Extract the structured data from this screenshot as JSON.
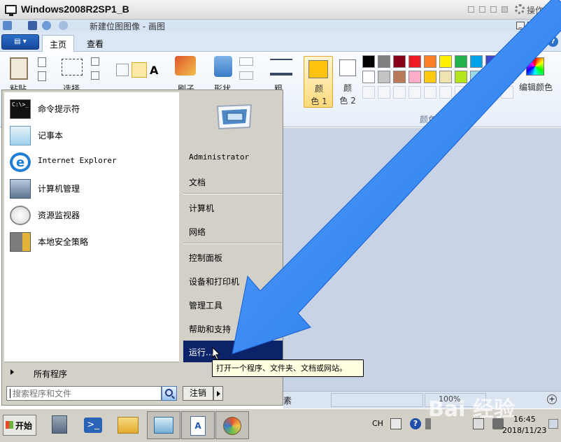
{
  "vm": {
    "title": "Windows2008R2SP1_B",
    "ops_label": "操作"
  },
  "paint": {
    "title": "新建位图图像 - 画图",
    "tabs": [
      "主页",
      "查看"
    ],
    "help": "?",
    "labels": {
      "paste": "粘贴",
      "select": "选择",
      "brush": "刷子",
      "shapes": "形状",
      "size": "粗",
      "color1": "颜\n色 1",
      "color2": "颜\n色 2",
      "edit_colors": "编辑颜色",
      "colors_group": "颜色"
    },
    "color1_value": "#ffc20e",
    "palette_row1": [
      "#000000",
      "#7f7f7f",
      "#880015",
      "#ed1c24",
      "#ff7f27",
      "#fff200",
      "#22b14c",
      "#00a2e8",
      "#3f48cc",
      "#a349a4"
    ],
    "palette_row2": [
      "#ffffff",
      "#c3c3c3",
      "#b97a57",
      "#ffaec9",
      "#ffc90e",
      "#efe4b0",
      "#b5e61d",
      "#99d9ea",
      "#7092be",
      "#c8bfe7"
    ],
    "status_text": "素",
    "zoom": "100%"
  },
  "startmenu": {
    "left_items": [
      {
        "label": "命令提示符",
        "icon": "cmd-icon"
      },
      {
        "label": "记事本",
        "icon": "notepad-icon"
      },
      {
        "label": "Internet Explorer",
        "icon": "ie-icon"
      },
      {
        "label": "计算机管理",
        "icon": "computer-management-icon"
      },
      {
        "label": "资源监视器",
        "icon": "resource-monitor-icon"
      },
      {
        "label": "本地安全策略",
        "icon": "security-policy-icon"
      }
    ],
    "all_programs": "所有程序",
    "search_placeholder": "搜索程序和文件",
    "right_items": [
      "Administrator",
      "文档",
      "计算机",
      "网络",
      "控制面板",
      "设备和打印机",
      "管理工具",
      "帮助和支持",
      "运行..."
    ],
    "logoff": "注销"
  },
  "tooltip": "打开一个程序、文件夹、文档或网站。",
  "taskbar": {
    "start": "开始",
    "ime": "CH",
    "time": "16:45",
    "date": "2018/11/23"
  },
  "watermark": "Bai 经验"
}
